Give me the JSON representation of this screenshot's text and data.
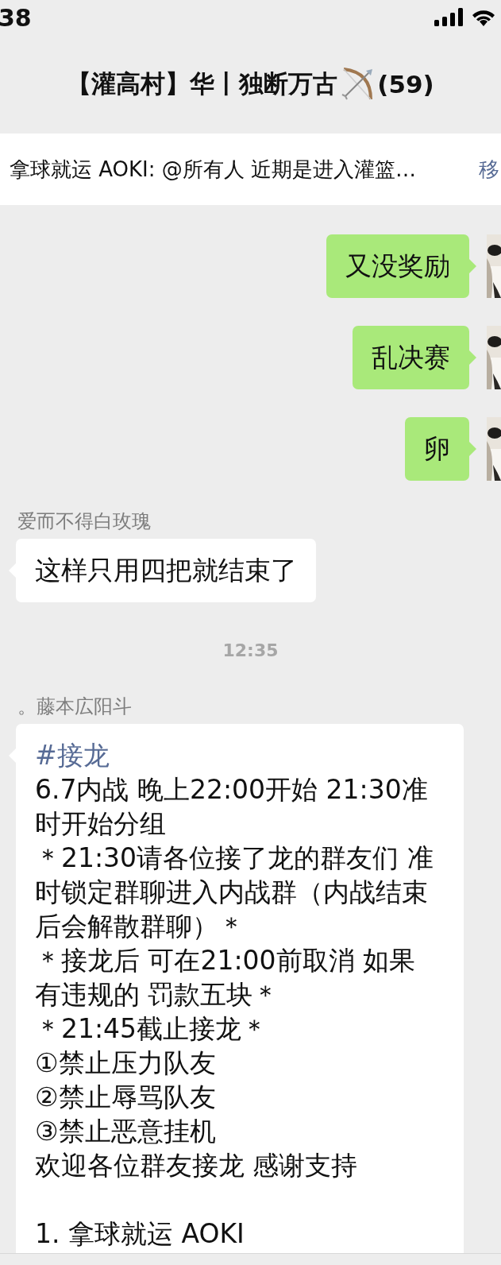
{
  "status_bar": {
    "time": "38"
  },
  "header": {
    "title": "【灌高村】华丨独断万古",
    "count": "(59)"
  },
  "pinned": {
    "text": "拿球就运 AOKI: @所有人 近期是进入灌篮…",
    "action": "移"
  },
  "messages": [
    {
      "kind": "outgoing",
      "text": "又没奖励"
    },
    {
      "kind": "outgoing",
      "text": "乱决赛"
    },
    {
      "kind": "outgoing",
      "text": "卵"
    },
    {
      "kind": "incoming",
      "sender": "爱而不得白玫瑰",
      "text": "这样只用四把就结束了"
    },
    {
      "kind": "time",
      "text": "12:35"
    },
    {
      "kind": "incoming_long",
      "sender": "。藤本広阳斗",
      "lines": [
        {
          "kind": "tag",
          "text": "#接龙"
        },
        {
          "kind": "text",
          "text": "6.7内战 晚上22:00开始 21:30准"
        },
        {
          "kind": "text",
          "text": "时开始分组"
        },
        {
          "kind": "text",
          "text": "＊21:30请各位接了龙的群友们 准"
        },
        {
          "kind": "text",
          "text": "时锁定群聊进入内战群（内战结束"
        },
        {
          "kind": "text",
          "text": "后会解散群聊）＊"
        },
        {
          "kind": "text",
          "text": "＊接龙后 可在21:00前取消 如果"
        },
        {
          "kind": "text",
          "text": "有违规的 罚款五块＊"
        },
        {
          "kind": "text",
          "text": "＊21:45截止接龙＊"
        },
        {
          "kind": "text",
          "text": "①禁止压力队友"
        },
        {
          "kind": "text",
          "text": "②禁止辱骂队友"
        },
        {
          "kind": "text",
          "text": "③禁止恶意挂机"
        },
        {
          "kind": "text",
          "text": "欢迎各位群友接龙 感谢支持"
        },
        {
          "kind": "list",
          "text": "1. 拿球就运 AOKI"
        }
      ]
    }
  ]
}
